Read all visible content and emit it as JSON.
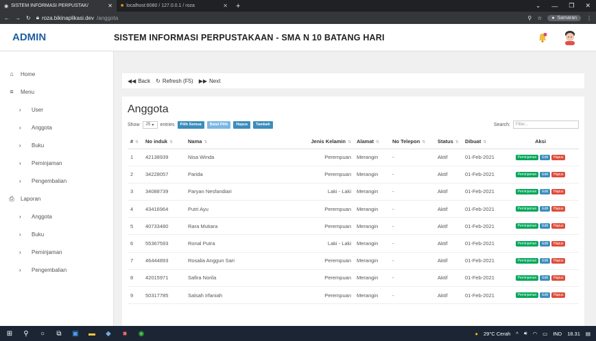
{
  "browser": {
    "tabs": [
      {
        "label": "SISTEM INFORMASI PERPUSTAK/",
        "active": true
      },
      {
        "label": "localhost:8080 / 127.0.0.1 / roza",
        "active": false
      }
    ],
    "url_host": "roza.bikinaplikasi.dev",
    "url_path": "/anggota",
    "profile_label": "Samaran"
  },
  "header": {
    "brand": "ADMIN",
    "title": "SISTEM INFORMASI PERPUSTAKAAN - SMA N 10 BATANG HARI"
  },
  "sidebar": {
    "items": [
      {
        "label": "Home",
        "icon": "home-icon",
        "glyph": "⌂",
        "sub": false
      },
      {
        "label": "Menu",
        "icon": "menu-icon",
        "glyph": "≡",
        "sub": false
      },
      {
        "label": "User",
        "icon": "chevron-right-icon",
        "glyph": "›",
        "sub": true
      },
      {
        "label": "Anggota",
        "icon": "chevron-right-icon",
        "glyph": "›",
        "sub": true
      },
      {
        "label": "Buku",
        "icon": "chevron-right-icon",
        "glyph": "›",
        "sub": true
      },
      {
        "label": "Peminjaman",
        "icon": "chevron-right-icon",
        "glyph": "›",
        "sub": true
      },
      {
        "label": "Pengembalian",
        "icon": "chevron-right-icon",
        "glyph": "›",
        "sub": true
      },
      {
        "label": "Laporan",
        "icon": "print-icon",
        "glyph": "⎙",
        "sub": false
      },
      {
        "label": "Anggota",
        "icon": "chevron-right-icon",
        "glyph": "›",
        "sub": true
      },
      {
        "label": "Buku",
        "icon": "chevron-right-icon",
        "glyph": "›",
        "sub": true
      },
      {
        "label": "Peminjaman",
        "icon": "chevron-right-icon",
        "glyph": "›",
        "sub": true
      },
      {
        "label": "Pengembalian",
        "icon": "chevron-right-icon",
        "glyph": "›",
        "sub": true
      }
    ]
  },
  "toolbar": {
    "back_label": "Back",
    "refresh_label": "Refresh (F5)",
    "next_label": "Next"
  },
  "card": {
    "title": "Anggota",
    "show_label": "Show",
    "entries_value": "25",
    "entries_label": "entries",
    "buttons": {
      "select_all": "Pilih Semua",
      "unselect": "Batal Pilih",
      "delete": "Hapus",
      "add": "Tambah"
    },
    "search_label": "Search:",
    "search_placeholder": "Filter..."
  },
  "table": {
    "columns": [
      "#",
      "No induk",
      "Nama",
      "Jenis Kelamin",
      "Alamat",
      "No Telepon",
      "Status",
      "Dibuat",
      "Aksi"
    ],
    "action_labels": {
      "borrow": "Peminjaman",
      "edit": "Edit",
      "delete": "Hapus"
    },
    "rows": [
      {
        "no": "1",
        "induk": "42138939",
        "nama": "Nisa Winda",
        "jk": "Perempuan",
        "alamat": "Merangin",
        "telp": "-",
        "status": "Aktif",
        "dibuat": "01-Feb-2021"
      },
      {
        "no": "2",
        "induk": "34228057",
        "nama": "Parida",
        "jk": "Perempuan",
        "alamat": "Merangin",
        "telp": "-",
        "status": "Aktif",
        "dibuat": "01-Feb-2021"
      },
      {
        "no": "3",
        "induk": "34088739",
        "nama": "Paryan Nesfandiari",
        "jk": "Laki - Laki",
        "alamat": "Merangin",
        "telp": "-",
        "status": "Aktif",
        "dibuat": "01-Feb-2021"
      },
      {
        "no": "4",
        "induk": "43416964",
        "nama": "Putri Ayu",
        "jk": "Perempuan",
        "alamat": "Merangin",
        "telp": "-",
        "status": "Aktif",
        "dibuat": "01-Feb-2021"
      },
      {
        "no": "5",
        "induk": "40733480",
        "nama": "Rara Mutiara",
        "jk": "Perempuan",
        "alamat": "Merangin",
        "telp": "-",
        "status": "Aktif",
        "dibuat": "01-Feb-2021"
      },
      {
        "no": "6",
        "induk": "55367593",
        "nama": "Ronal Putra",
        "jk": "Laki - Laki",
        "alamat": "Merangin",
        "telp": "-",
        "status": "Aktif",
        "dibuat": "01-Feb-2021"
      },
      {
        "no": "7",
        "induk": "46444893",
        "nama": "Rosalia Anggun Sari",
        "jk": "Perempuan",
        "alamat": "Merangin",
        "telp": "-",
        "status": "Aktif",
        "dibuat": "01-Feb-2021"
      },
      {
        "no": "8",
        "induk": "42015971",
        "nama": "Safira Norila",
        "jk": "Perempuan",
        "alamat": "Merangin",
        "telp": "-",
        "status": "Aktif",
        "dibuat": "01-Feb-2021"
      },
      {
        "no": "9",
        "induk": "50317785",
        "nama": "Salsah Irfaniah",
        "jk": "Perempuan",
        "alamat": "Merangin",
        "telp": "-",
        "status": "Aktif",
        "dibuat": "01-Feb-2021"
      }
    ]
  },
  "taskbar": {
    "weather": "29°C Cerah",
    "lang": "IND",
    "time": "18.31"
  }
}
